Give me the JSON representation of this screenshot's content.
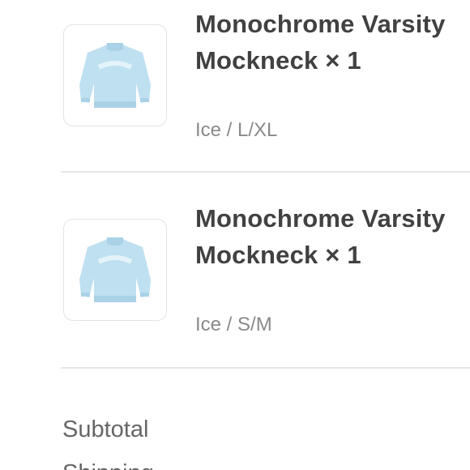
{
  "order_items": [
    {
      "title": "Monochrome Varsity Mockneck × 1",
      "variant": "Ice / L/XL",
      "image_icon": "sweater-thumbnail"
    },
    {
      "title": "Monochrome Varsity Mockneck × 1",
      "variant": "Ice / S/M",
      "image_icon": "sweater-thumbnail"
    }
  ],
  "summary": {
    "subtotal_label": "Subtotal",
    "shipping_label": "Shipping"
  },
  "colors": {
    "sweater": "#bfe0f0",
    "sweater_shade": "#a9d2e6",
    "text_dark": "#414141",
    "text_muted": "#8a8a8a"
  }
}
